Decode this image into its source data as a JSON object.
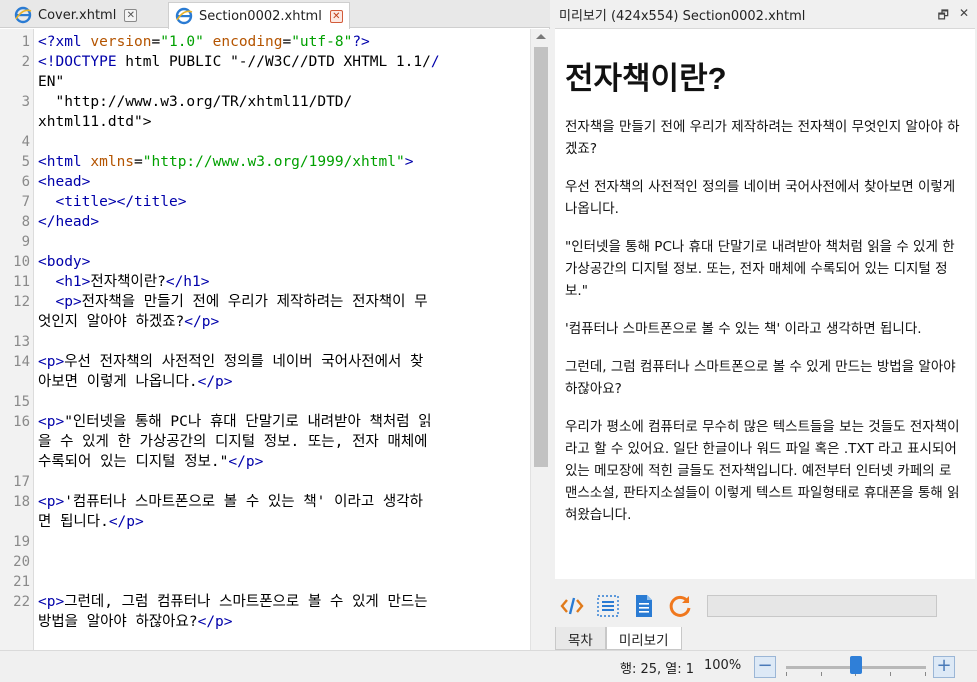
{
  "tabs": [
    {
      "label": "Cover.xhtml",
      "active": false
    },
    {
      "label": "Section0002.xhtml",
      "active": true
    }
  ],
  "editor": {
    "lines": [
      {
        "n": "1",
        "code": "<?xml version=\"1.0\" encoding=\"utf-8\"?>"
      },
      {
        "n": "2",
        "code": "<!DOCTYPE html PUBLIC \"-//W3C//DTD XHTML 1.1//"
      },
      {
        "n": "",
        "code": "EN\""
      },
      {
        "n": "3",
        "code": "  \"http://www.w3.org/TR/xhtml11/DTD/"
      },
      {
        "n": "",
        "code": "xhtml11.dtd\">"
      },
      {
        "n": "4",
        "code": ""
      },
      {
        "n": "5",
        "code": "<html xmlns=\"http://www.w3.org/1999/xhtml\">"
      },
      {
        "n": "6",
        "code": "<head>"
      },
      {
        "n": "7",
        "code": "  <title></title>"
      },
      {
        "n": "8",
        "code": "</head>"
      },
      {
        "n": "9",
        "code": ""
      },
      {
        "n": "10",
        "code": "<body>"
      },
      {
        "n": "11",
        "code": "  <h1>전자책이란?</h1>"
      },
      {
        "n": "12",
        "code": "  <p>전자책을 만들기 전에 우리가 제작하려는 전자책이 무"
      },
      {
        "n": "",
        "code": "엇인지 알아야 하겠죠?</p>"
      },
      {
        "n": "13",
        "code": ""
      },
      {
        "n": "14",
        "code": "<p>우선 전자책의 사전적인 정의를 네이버 국어사전에서 찾"
      },
      {
        "n": "",
        "code": "아보면 이렇게 나옵니다.</p>"
      },
      {
        "n": "15",
        "code": ""
      },
      {
        "n": "16",
        "code": "<p>\"인터넷을 통해 PC나 휴대 단말기로 내려받아 책처럼 읽"
      },
      {
        "n": "",
        "code": "을 수 있게 한 가상공간의 디지털 정보. 또는, 전자 매체에"
      },
      {
        "n": "",
        "code": "수록되어 있는 디지털 정보.\"</p>"
      },
      {
        "n": "17",
        "code": ""
      },
      {
        "n": "18",
        "code": "<p>'컴퓨터나 스마트폰으로 볼 수 있는 책' 이라고 생각하"
      },
      {
        "n": "",
        "code": "면 됩니다.</p>"
      },
      {
        "n": "19",
        "code": ""
      },
      {
        "n": "20",
        "code": ""
      },
      {
        "n": "21",
        "code": ""
      },
      {
        "n": "22",
        "code": "<p>그런데, 그럼 컴퓨터나 스마트폰으로 볼 수 있게 만드는"
      },
      {
        "n": "",
        "code": "방법을 알아야 하잖아요?</p>"
      }
    ]
  },
  "preview": {
    "title": "미리보기 (424x554) Section0002.xhtml",
    "heading": "전자책이란?",
    "paragraphs": [
      "전자책을 만들기 전에 우리가 제작하려는 전자책이 무엇인지 알아야 하겠죠?",
      "우선 전자책의 사전적인 정의를 네이버 국어사전에서 찾아보면 이렇게 나옵니다.",
      "\"인터넷을 통해 PC나 휴대 단말기로 내려받아 책처럼 읽을 수 있게 한 가상공간의 디지털 정보. 또는, 전자 매체에 수록되어 있는 디지털 정보.\"",
      "'컴퓨터나 스마트폰으로 볼 수 있는 책' 이라고 생각하면 됩니다.",
      "그런데, 그럼 컴퓨터나 스마트폰으로 볼 수 있게 만드는 방법을 알아야 하잖아요?",
      "우리가 평소에 컴퓨터로 무수히 많은 텍스트들을 보는 것들도 전자책이라고 할 수 있어요. 일단 한글이나 워드 파일 혹은 .TXT 라고 표시되어 있는 메모장에 적힌 글들도 전자책입니다. 예전부터 인터넷 카페의 로맨스소설, 판타지소설들이 이렇게 텍스트 파일형태로 휴대폰을 통해 읽혀왔습니다."
    ],
    "tabs": [
      "목차",
      "미리보기"
    ],
    "active_tab": "미리보기"
  },
  "status": {
    "position": "행: 25, 열: 1",
    "zoom": "100%",
    "zoom_level_fraction": 0.5
  },
  "colors": {
    "tag": "#0000aa",
    "attr": "#b45400",
    "value": "#00a000",
    "accent": "#2f7fd8"
  }
}
